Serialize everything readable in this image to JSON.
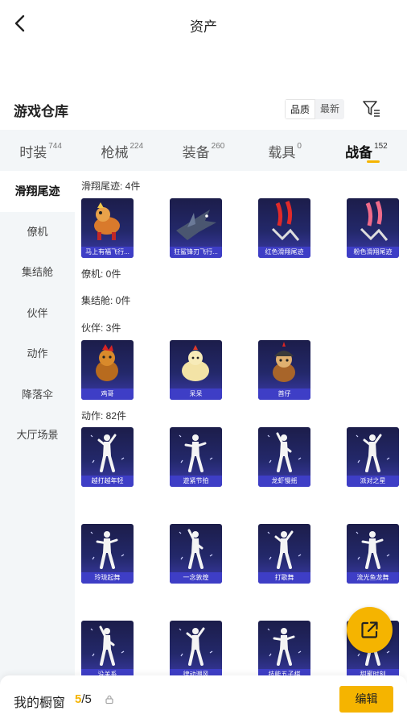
{
  "header": {
    "title": "资产"
  },
  "warehouse": {
    "title": "游戏仓库",
    "sort_options": [
      "品质",
      "最新"
    ]
  },
  "tabs": [
    {
      "label": "时装",
      "count": "744"
    },
    {
      "label": "枪械",
      "count": "224"
    },
    {
      "label": "装备",
      "count": "260"
    },
    {
      "label": "载具",
      "count": "0"
    },
    {
      "label": "战备",
      "count": "152"
    }
  ],
  "sidebar": {
    "items": [
      "滑翔尾迹",
      "僚机",
      "集结舱",
      "伙伴",
      "动作",
      "降落伞",
      "大厅场景"
    ]
  },
  "groups": {
    "glide": {
      "header": "滑翔尾迹: 4件",
      "items": [
        "马上有福飞行...",
        "狂鲨锋刃飞行...",
        "红色滑翔尾迹",
        "粉色滑翔尾迹"
      ]
    },
    "wingman": {
      "header": "僚机: 0件"
    },
    "capsule": {
      "header": "集结舱: 0件"
    },
    "partner": {
      "header": "伙伴: 3件",
      "items": [
        "鸡哥",
        "呆呆",
        "酋仔"
      ]
    },
    "emote": {
      "header": "动作: 82件",
      "items": [
        "越打越年轻",
        "遊紧节拍",
        "龙虾慢摇",
        "派对之星",
        "玲珑起舞",
        "一念敦煌",
        "打歌舞",
        "流光鱼龙舞",
        "没关系",
        "律动潮风",
        "技能五子棋",
        "甜蜜时刻"
      ]
    }
  },
  "bottom": {
    "showcase_label": "我的橱窗",
    "count_current": "5",
    "count_total": "/5",
    "edit_label": "编辑"
  },
  "colors": {
    "accent": "#f5b400",
    "card_top": "#1c1d4a",
    "card_label": "#3e3ec6"
  }
}
